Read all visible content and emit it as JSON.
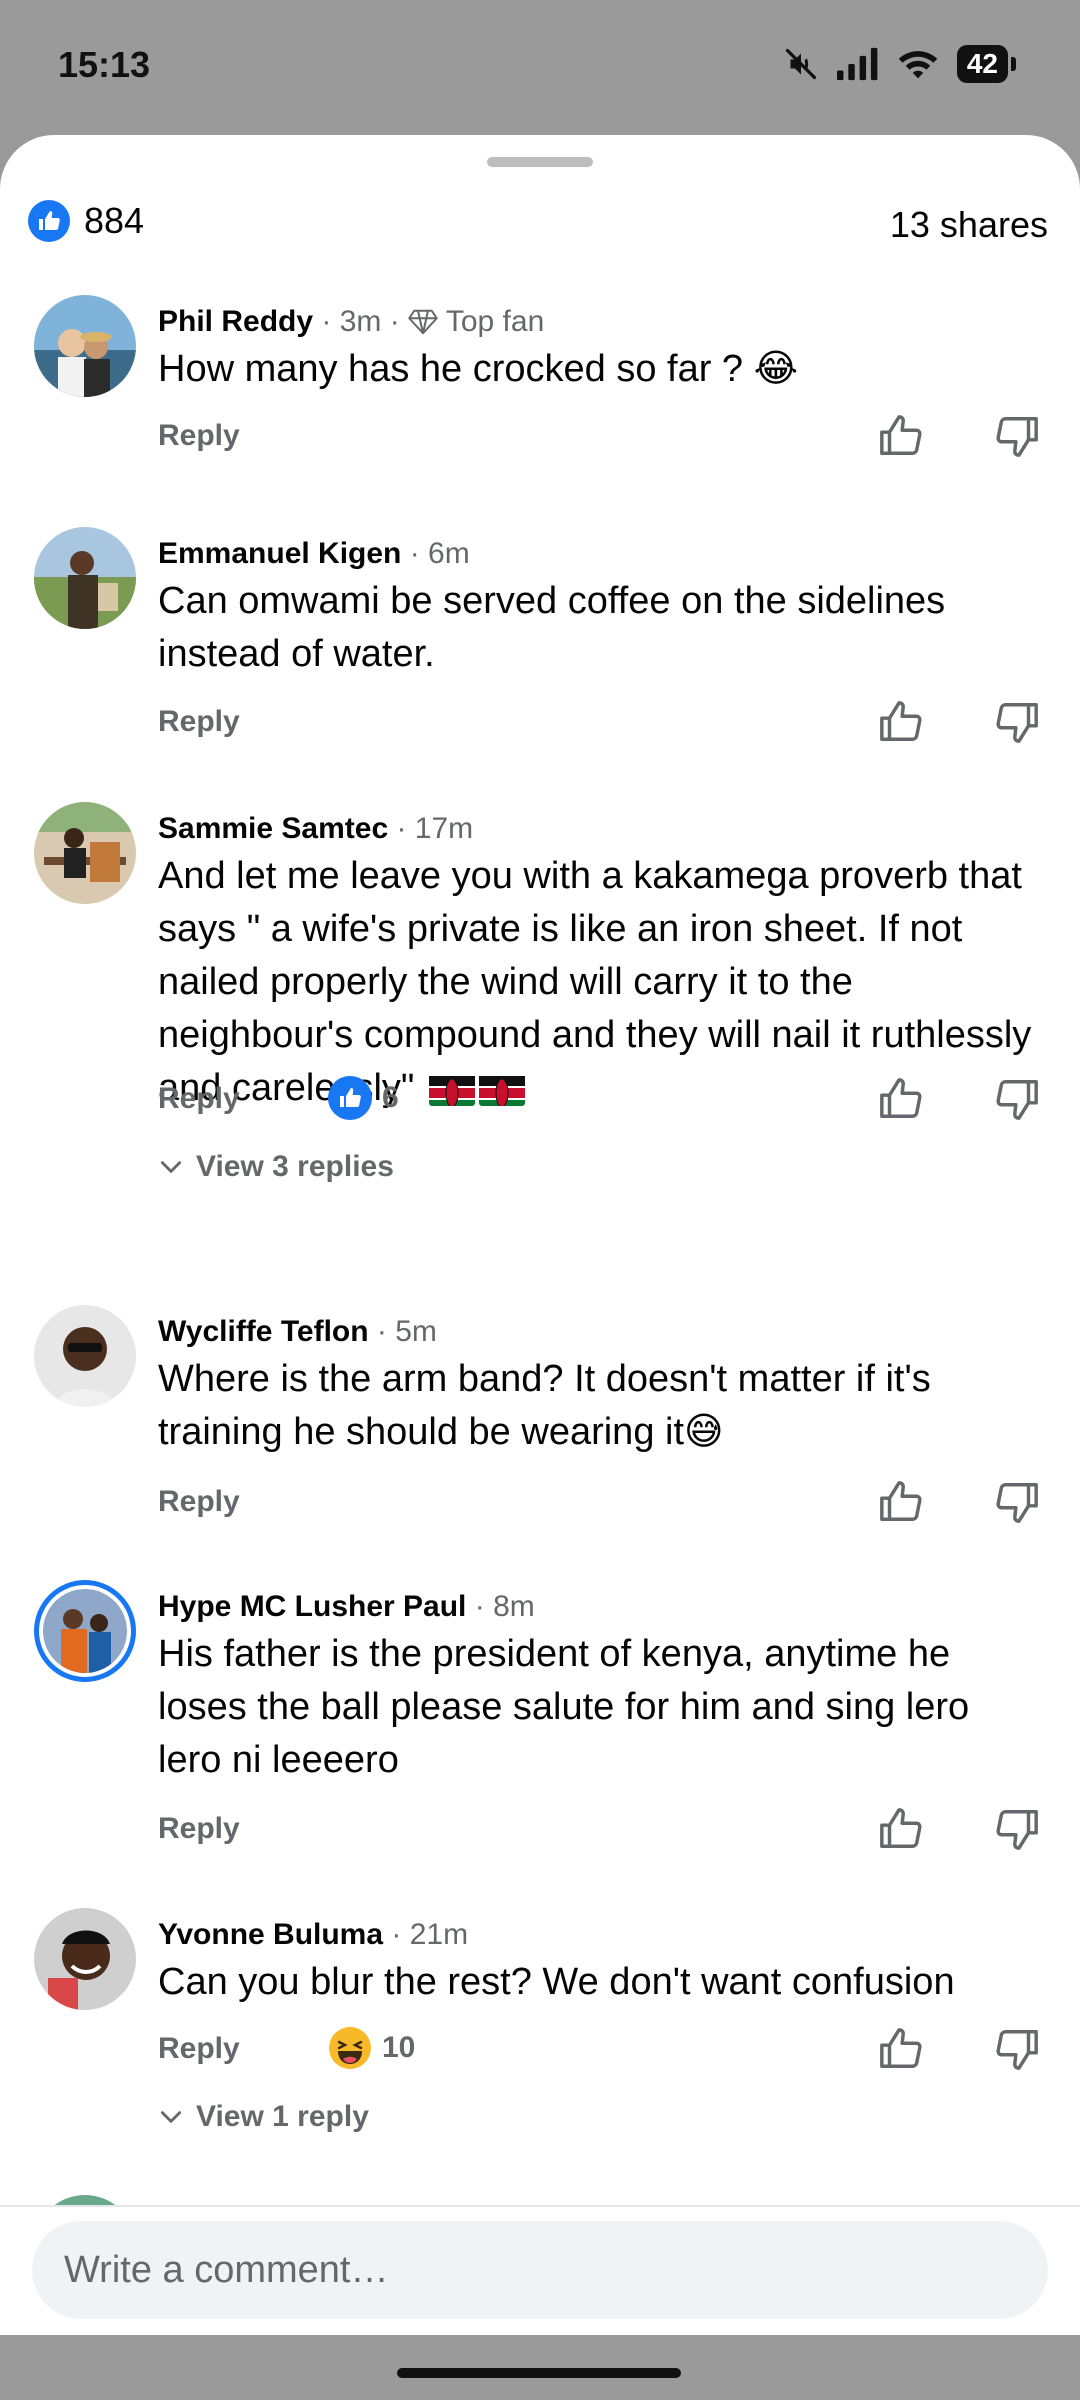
{
  "status_bar": {
    "time": "15:13",
    "battery": "42"
  },
  "summary": {
    "likes": "884",
    "shares": "13 shares"
  },
  "comments": [
    {
      "author": "Phil Reddy",
      "time": "· 3m ·",
      "badge": "Top fan",
      "text": "How many has he crocked so far ? 😂",
      "reply": "Reply"
    },
    {
      "author": "Emmanuel Kigen",
      "time": "· 6m",
      "text": "Can omwami be served coffee on the sidelines instead of water.",
      "reply": "Reply"
    },
    {
      "author": "Sammie Samtec",
      "time": "· 17m",
      "text": "And let me leave you with a kakamega proverb that says \" a wife's private is like an iron sheet. If not nailed properly the wind will carry it to the neighbour's compound and they will nail it ruthlessly and carelessly\"",
      "reply": "Reply",
      "reactions": "6",
      "view_replies": "View 3 replies"
    },
    {
      "author": "Wycliffe Teflon",
      "time": "· 5m",
      "text": "Where is the arm band? It doesn't matter if it's training he should be wearing it😅",
      "reply": "Reply"
    },
    {
      "author": "Hype MC Lusher Paul",
      "time": "· 8m",
      "text": "His father is the president of kenya, anytime he loses the ball please salute for him and sing lero lero ni leeeero",
      "reply": "Reply"
    },
    {
      "author": "Yvonne Buluma",
      "time": "· 21m",
      "text": "Can you blur the rest? We don't want confusion",
      "reply": "Reply",
      "reactions": "10",
      "view_replies": "View 1 reply"
    }
  ],
  "compose": {
    "placeholder": "Write a comment…"
  },
  "colors": {
    "accent": "#1877f2",
    "secondary_text": "#65676b"
  }
}
